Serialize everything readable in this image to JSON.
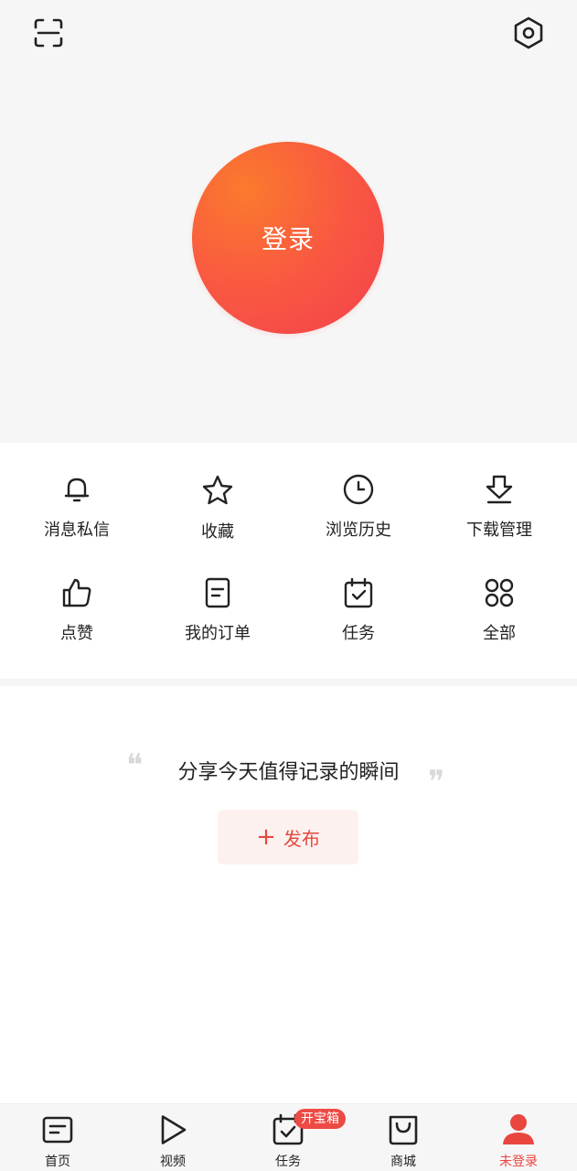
{
  "login": {
    "label": "登录"
  },
  "quick_actions": [
    {
      "label": "消息私信",
      "icon": "bell-icon"
    },
    {
      "label": "收藏",
      "icon": "star-icon"
    },
    {
      "label": "浏览历史",
      "icon": "clock-icon"
    },
    {
      "label": "下载管理",
      "icon": "download-icon"
    },
    {
      "label": "点赞",
      "icon": "thumbs-up-icon"
    },
    {
      "label": "我的订单",
      "icon": "order-icon"
    },
    {
      "label": "任务",
      "icon": "calendar-check-icon"
    },
    {
      "label": "全部",
      "icon": "grid-dots-icon"
    }
  ],
  "share": {
    "text": "分享今天值得记录的瞬间",
    "publish_label": "发布"
  },
  "bottom_nav": {
    "items": [
      {
        "label": "首页",
        "icon": "home-doc-icon"
      },
      {
        "label": "视频",
        "icon": "play-icon"
      },
      {
        "label": "任务",
        "icon": "task-icon"
      },
      {
        "label": "商城",
        "icon": "shopping-bag-icon"
      },
      {
        "label": "未登录",
        "icon": "user-icon",
        "active": true
      }
    ],
    "badge": "开宝箱"
  },
  "colors": {
    "accent": "#e8463f",
    "header_bg": "#f7f6f6",
    "login_gradient_start": "#fb7a2e",
    "login_gradient_end": "#f4404f"
  }
}
